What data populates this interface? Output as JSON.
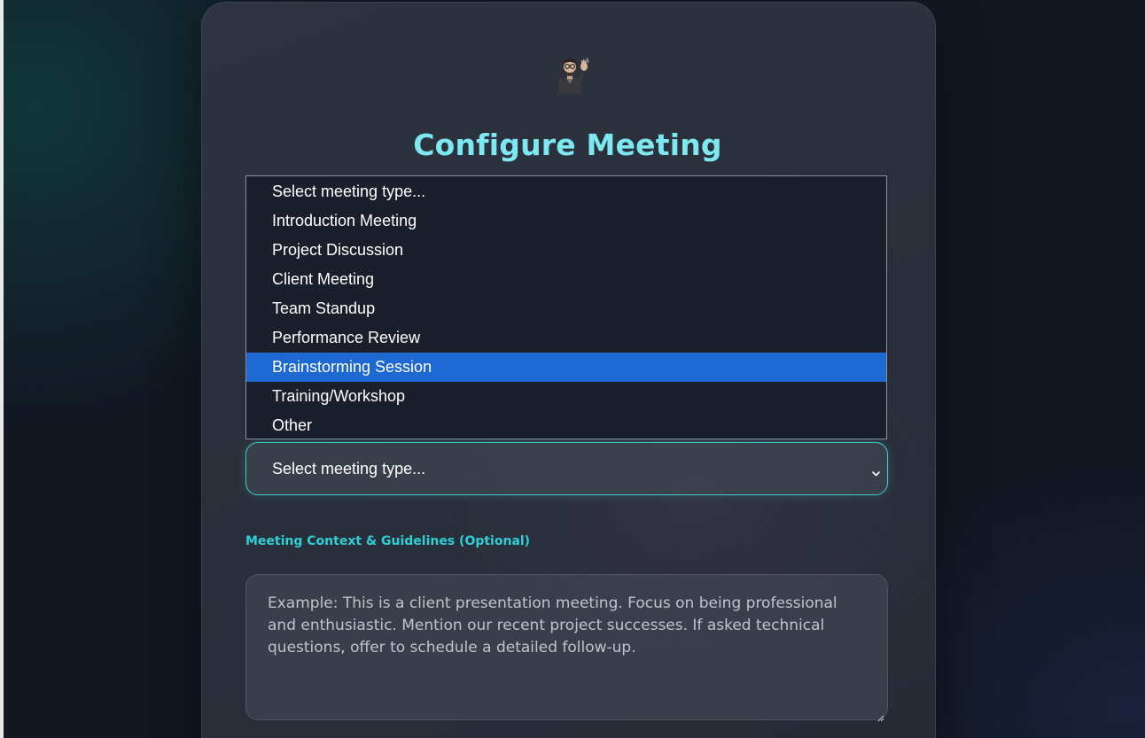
{
  "page": {
    "title": "Configure Meeting",
    "avatar_icon": "person-waving-emoji-icon"
  },
  "meeting_type": {
    "selected_value": "Select meeting type...",
    "highlighted_index": 6,
    "options": [
      "Select meeting type...",
      "Introduction Meeting",
      "Project Discussion",
      "Client Meeting",
      "Team Standup",
      "Performance Review",
      "Brainstorming Session",
      "Training/Workshop",
      "Other"
    ]
  },
  "context": {
    "label": "Meeting Context & Guidelines (Optional)",
    "placeholder": "Example: This is a client presentation meeting. Focus on being professional and enthusiastic. Mention our recent project successes. If asked technical questions, offer to schedule a detailed follow-up."
  },
  "colors": {
    "title": "#7de8ef",
    "accent": "#2fcfd6",
    "highlight": "#1e68d1",
    "background": "#121722",
    "card": "#2a303b"
  }
}
